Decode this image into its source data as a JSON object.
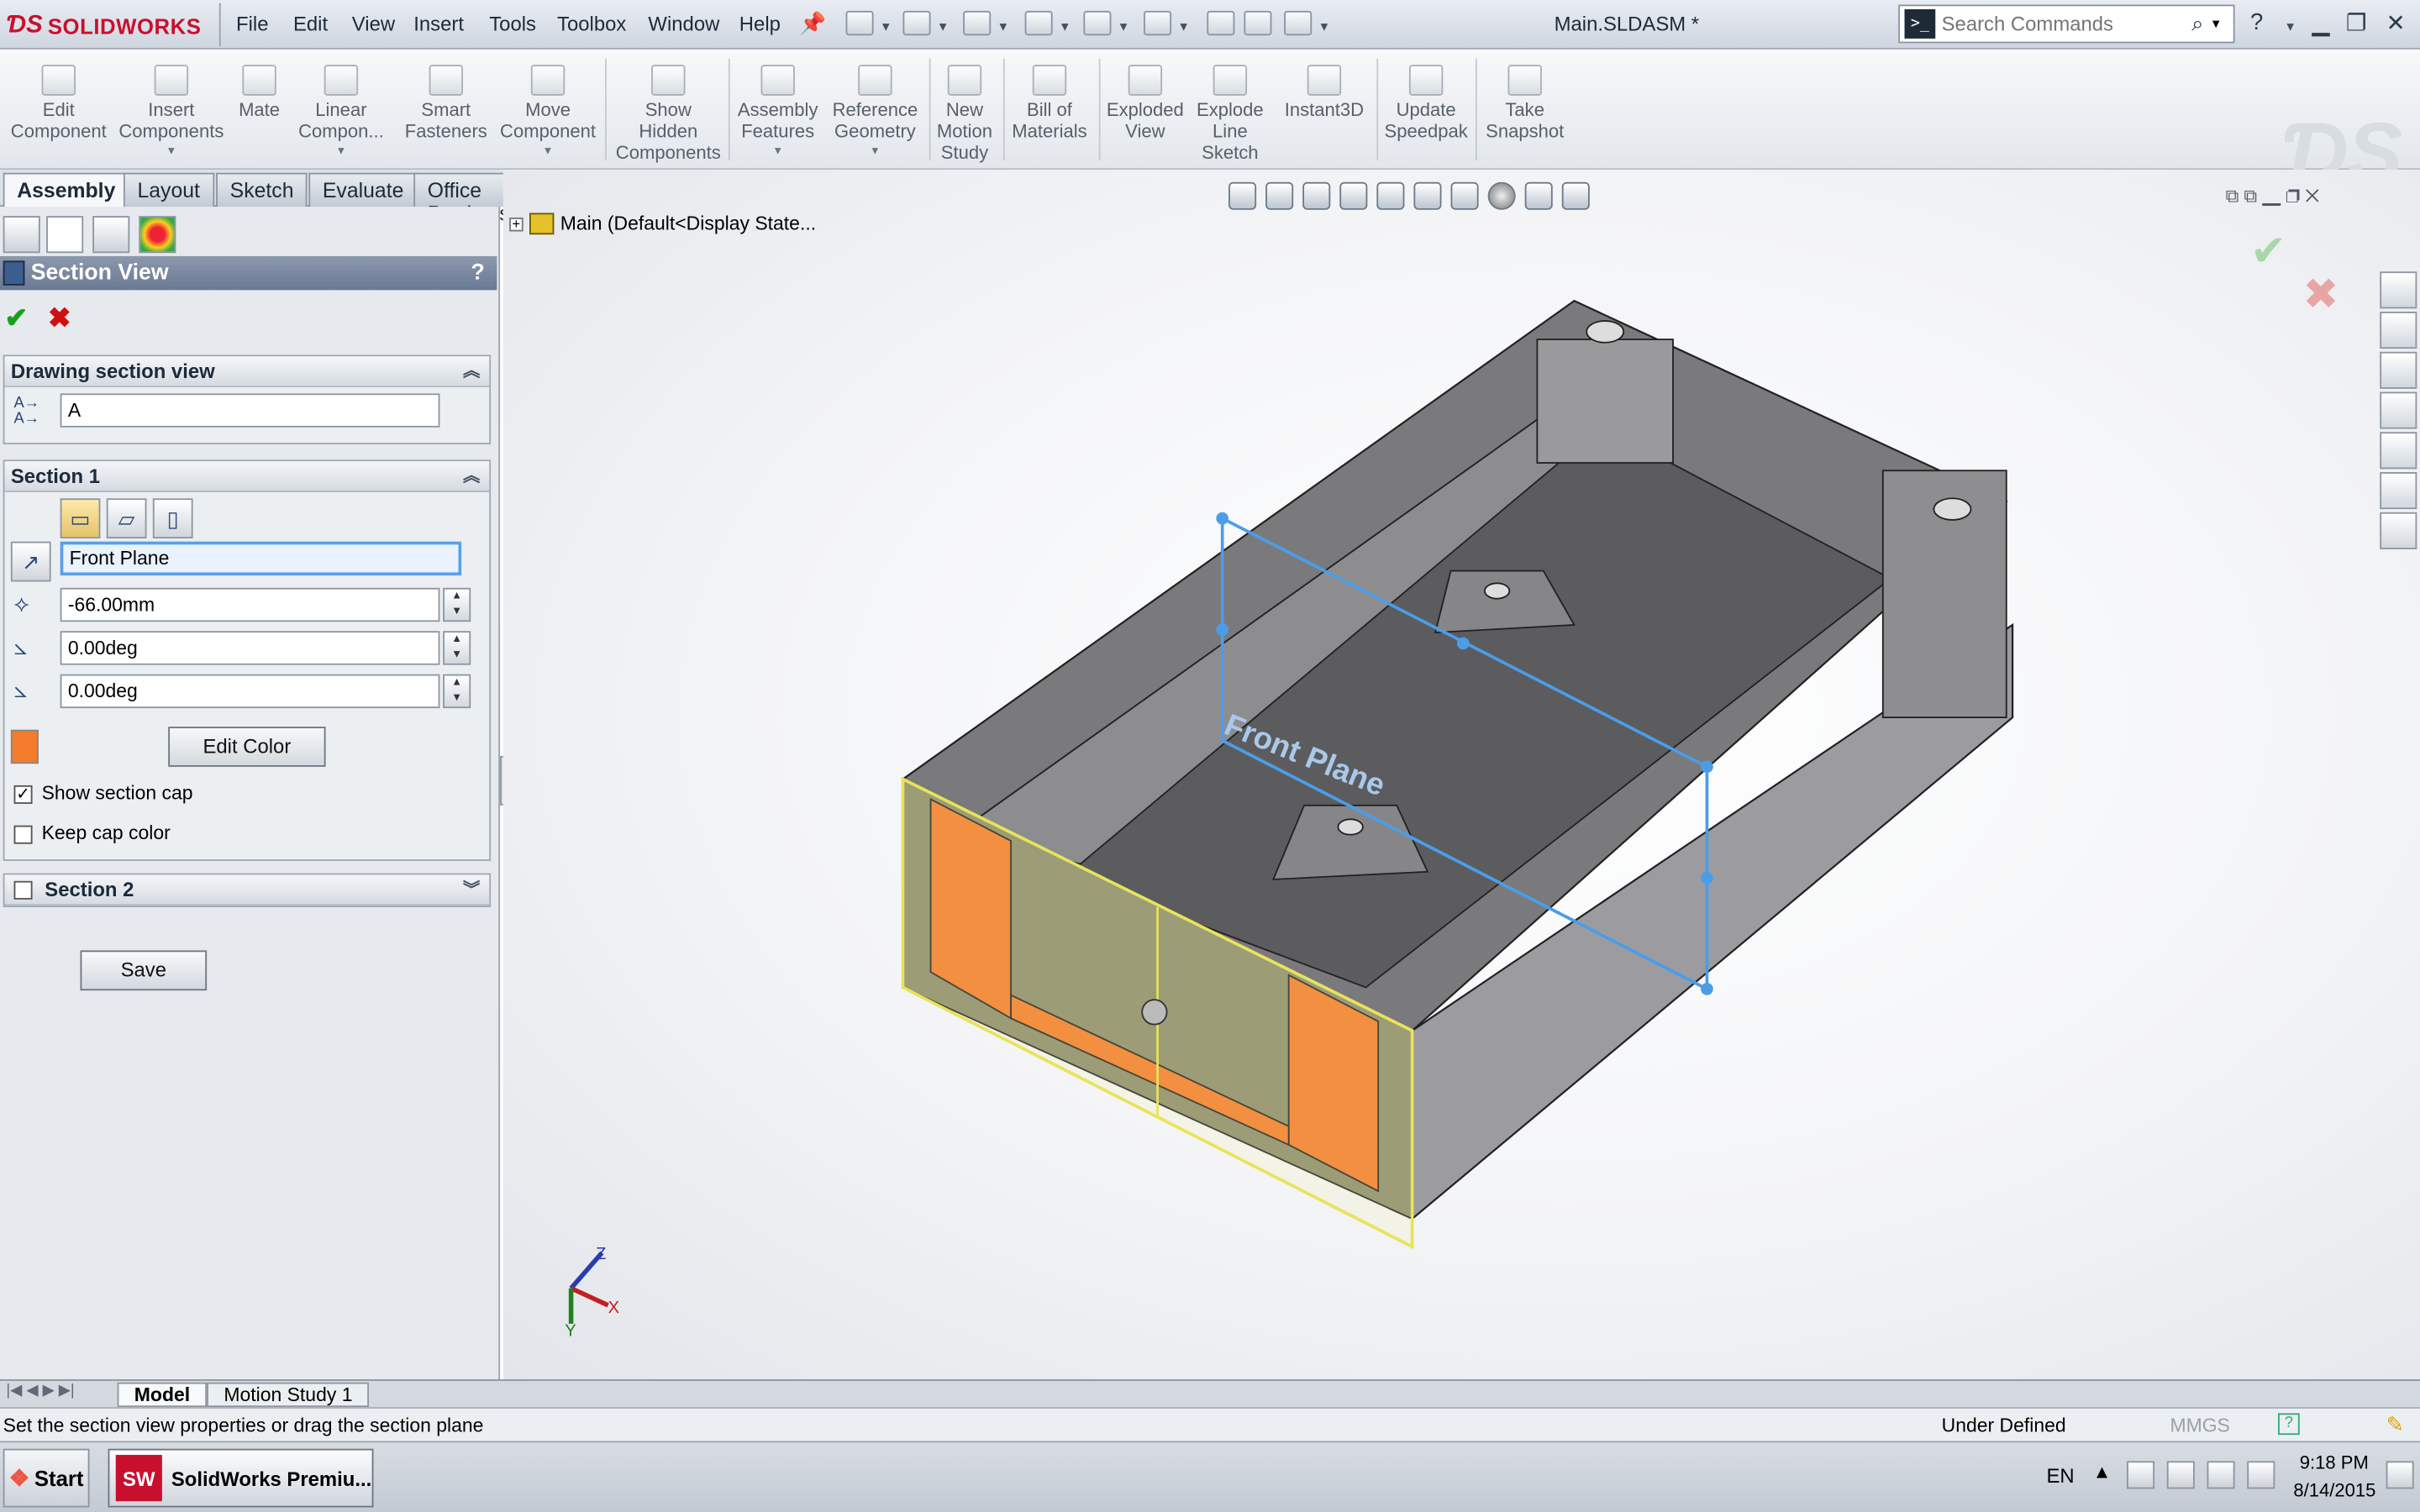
{
  "app": {
    "logo": "SOLIDWORKS",
    "document_title": "Main.SLDASM *"
  },
  "menu": [
    "File",
    "Edit",
    "View",
    "Insert",
    "Tools",
    "Toolbox",
    "Window",
    "Help"
  ],
  "search": {
    "placeholder": "Search Commands"
  },
  "command_manager": [
    {
      "label": "Edit\nComponent",
      "icon": "edit-component-icon"
    },
    {
      "label": "Insert\nComponents",
      "icon": "insert-components-icon"
    },
    {
      "label": "Mate",
      "icon": "mate-icon"
    },
    {
      "label": "Linear\nCompon...",
      "icon": "linear-pattern-icon"
    },
    {
      "label": "Smart\nFasteners",
      "icon": "smart-fasteners-icon"
    },
    {
      "label": "Move\nComponent",
      "icon": "move-component-icon"
    },
    {
      "label": "Show\nHidden\nComponents",
      "icon": "show-hidden-icon"
    },
    {
      "label": "Assembly\nFeatures",
      "icon": "assembly-features-icon"
    },
    {
      "label": "Reference\nGeometry",
      "icon": "reference-geometry-icon"
    },
    {
      "label": "New\nMotion\nStudy",
      "icon": "motion-study-icon"
    },
    {
      "label": "Bill of\nMaterials",
      "icon": "bom-icon"
    },
    {
      "label": "Exploded\nView",
      "icon": "exploded-view-icon"
    },
    {
      "label": "Explode\nLine\nSketch",
      "icon": "explode-line-icon"
    },
    {
      "label": "Instant3D",
      "icon": "instant3d-icon"
    },
    {
      "label": "Update\nSpeedpak",
      "icon": "speedpak-icon"
    },
    {
      "label": "Take\nSnapshot",
      "icon": "snapshot-icon"
    }
  ],
  "tabs": [
    "Assembly",
    "Layout",
    "Sketch",
    "Evaluate",
    "Office Products"
  ],
  "property_manager": {
    "title": "Section View",
    "help": "?",
    "drawing_section": {
      "header": "Drawing section view",
      "name_value": "A"
    },
    "section1": {
      "header": "Section 1",
      "plane": "Front Plane",
      "offset": "-66.00mm",
      "angle1": "0.00deg",
      "angle2": "0.00deg",
      "edit_color": "Edit Color",
      "cap_color": "#f47a2c",
      "show_cap_label": "Show section cap",
      "show_cap_checked": true,
      "keep_color_label": "Keep cap color",
      "keep_color_checked": false
    },
    "section2": {
      "header": "Section 2",
      "checked": false
    },
    "save": "Save"
  },
  "viewport": {
    "tree_root": "Main  (Default<Display State...",
    "plane_label": "Front Plane",
    "axes": {
      "x": "X",
      "y": "Y",
      "z": "Z"
    }
  },
  "model_tabs": [
    "Model",
    "Motion Study 1"
  ],
  "status": {
    "message": "Set the section view properties or drag the section plane",
    "state": "Under Defined",
    "units": "MMGS"
  },
  "taskbar": {
    "start": "Start",
    "app": "SolidWorks Premiu...",
    "lang": "EN",
    "time": "9:18 PM",
    "date": "8/14/2015"
  }
}
